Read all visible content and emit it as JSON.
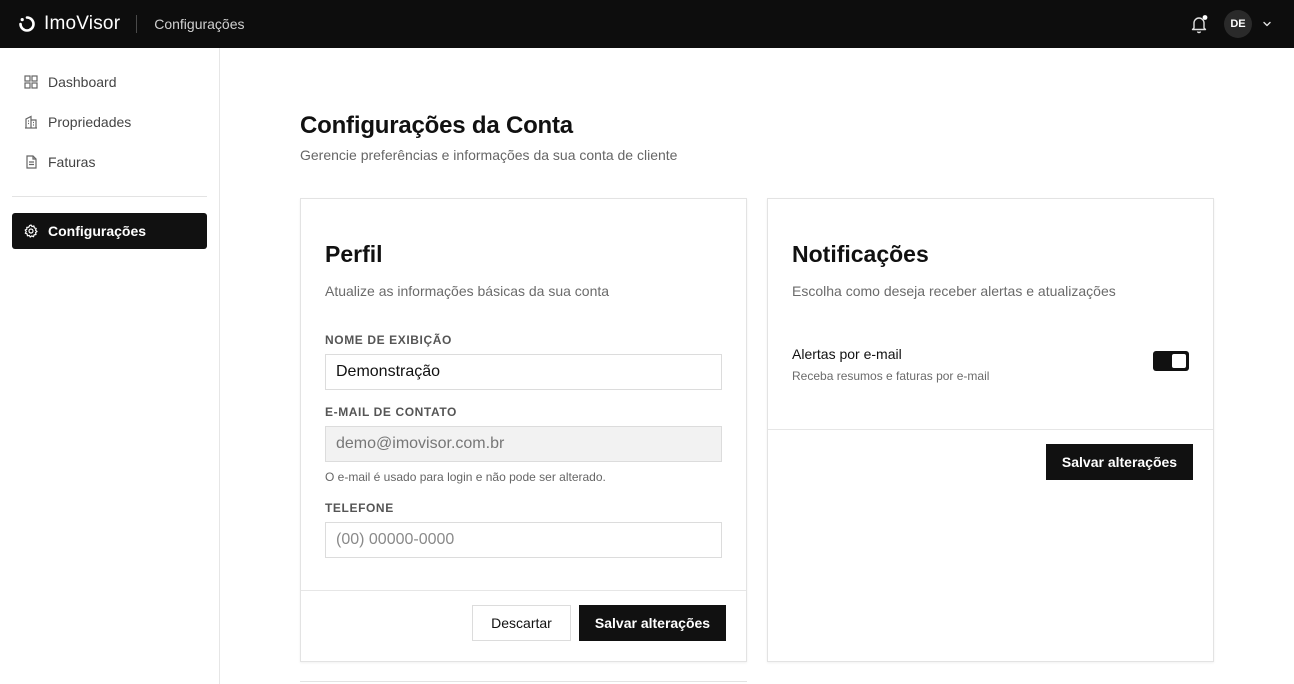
{
  "app": {
    "brand": "ImoVisor",
    "section": "Configurações",
    "user_initials": "DE"
  },
  "sidebar": {
    "items": [
      {
        "label": "Dashboard",
        "icon": "grid-icon"
      },
      {
        "label": "Propriedades",
        "icon": "building-icon"
      },
      {
        "label": "Faturas",
        "icon": "document-icon"
      },
      {
        "label": "Configurações",
        "icon": "gear-icon",
        "active": true
      }
    ]
  },
  "page": {
    "title": "Configurações da Conta",
    "subtitle": "Gerencie preferências e informações da sua conta de cliente"
  },
  "profile": {
    "title": "Perfil",
    "subtitle": "Atualize as informações básicas da sua conta",
    "name_label": "NOME DE EXIBIÇÃO",
    "name_value": "Demonstração",
    "email_label": "E-MAIL DE CONTATO",
    "email_value": "demo@imovisor.com.br",
    "email_hint": "O e-mail é usado para login e não pode ser alterado.",
    "phone_label": "TELEFONE",
    "phone_placeholder": "(00) 00000-0000",
    "discard_label": "Descartar",
    "save_label": "Salvar alterações"
  },
  "notifications": {
    "title": "Notificações",
    "subtitle": "Escolha como deseja receber alertas e atualizações",
    "email_alerts_label": "Alertas por e-mail",
    "email_alerts_desc": "Receba resumos e faturas por e-mail",
    "email_alerts_enabled": true,
    "save_label": "Salvar alterações"
  },
  "colors": {
    "topbar": "#0d0d0d",
    "accent": "#111111",
    "border": "#e3e3e3"
  }
}
